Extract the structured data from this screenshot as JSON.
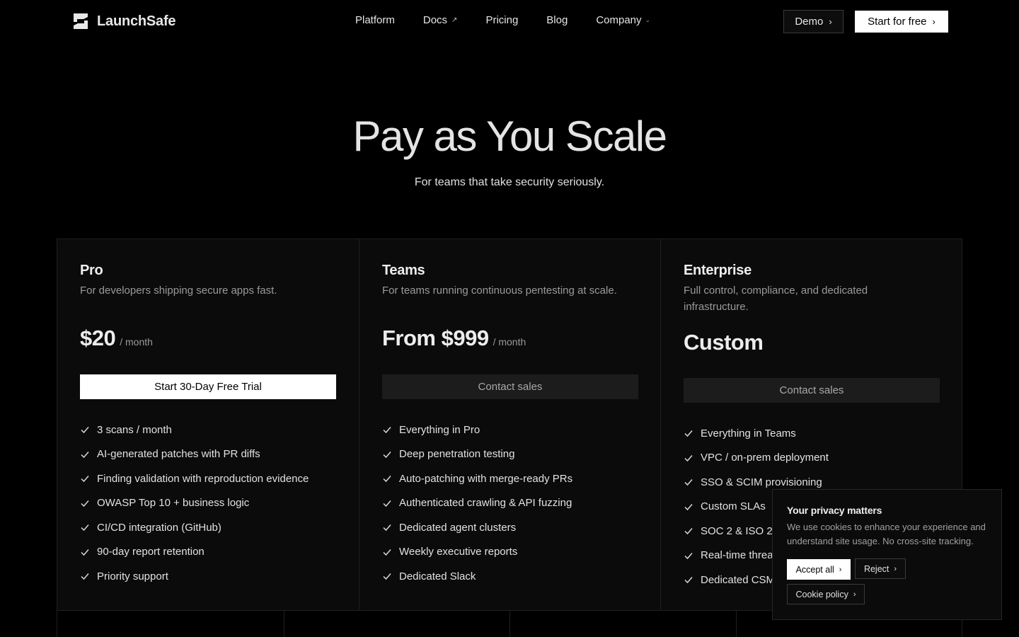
{
  "nav": {
    "brand": "LaunchSafe",
    "links": [
      {
        "label": "Platform"
      },
      {
        "label": "Docs",
        "icon": "external-arrow-icon"
      },
      {
        "label": "Pricing"
      },
      {
        "label": "Blog"
      },
      {
        "label": "Company",
        "icon": "chevron-down-icon"
      }
    ],
    "demo_label": "Demo",
    "start_label": "Start for free"
  },
  "hero": {
    "title": "Pay as You Scale",
    "subtitle": "For teams that take security seriously."
  },
  "plans": [
    {
      "name": "Pro",
      "description": "For developers shipping secure apps fast.",
      "price": "$20",
      "unit": "/ month",
      "cta": "Start 30-Day Free Trial",
      "features": [
        "3 scans / month",
        "AI-generated patches with PR diffs",
        "Finding validation with reproduction evidence",
        "OWASP Top 10 + business logic",
        "CI/CD integration (GitHub)",
        "90-day report retention",
        "Priority support"
      ]
    },
    {
      "name": "Teams",
      "description": "For teams running continuous pentesting at scale.",
      "price": "From $999",
      "unit": "/ month",
      "cta": "Contact sales",
      "features": [
        "Everything in Pro",
        "Deep penetration testing",
        "Auto-patching with merge-ready PRs",
        "Authenticated crawling & API fuzzing",
        "Dedicated agent clusters",
        "Weekly executive reports",
        "Dedicated Slack"
      ]
    },
    {
      "name": "Enterprise",
      "description": "Full control, compliance, and dedicated infrastructure.",
      "price": "Custom",
      "cta": "Contact sales",
      "features": [
        "Everything in Teams",
        "VPC / on-prem deployment",
        "SSO & SCIM provisioning",
        "Custom SLAs",
        "SOC 2 & ISO 2",
        "Real-time threa",
        "Dedicated CSM"
      ]
    }
  ],
  "cookie": {
    "title": "Your privacy matters",
    "body": "We use cookies to enhance your experience and understand site usage. No cross-site tracking.",
    "accept": "Accept all",
    "reject": "Reject",
    "policy": "Cookie policy"
  },
  "colors": {
    "background": "#000000",
    "card": "#0b0b0b",
    "border": "#1f1f1f",
    "primary_button": "#ffffff",
    "secondary_button": "#1c1c1c",
    "muted_text": "#9a9a9a"
  }
}
